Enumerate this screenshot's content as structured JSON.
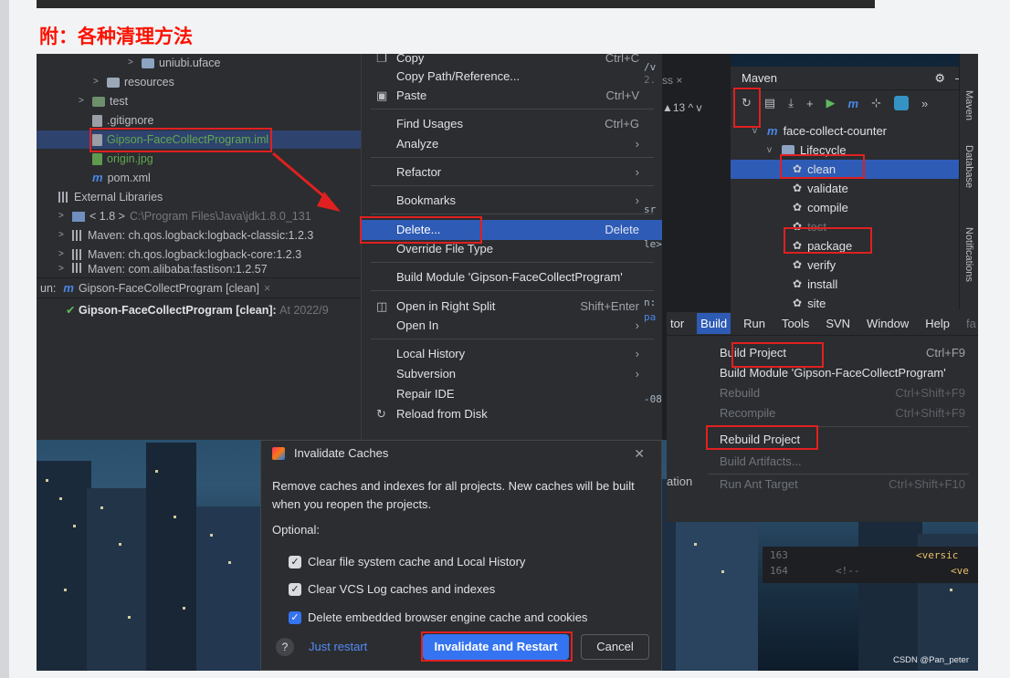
{
  "page": {
    "heading": "附：各种清理方法",
    "watermark": "CSDN @Pan_peter"
  },
  "project_tree": {
    "items": [
      {
        "label": "uniubi.uface"
      },
      {
        "label": "resources"
      },
      {
        "label": "test"
      },
      {
        "label": ".gitignore"
      },
      {
        "label": "Gipson-FaceCollectProgram.iml"
      },
      {
        "label": "origin.jpg"
      },
      {
        "label": "pom.xml"
      },
      {
        "label": "External Libraries"
      },
      {
        "label": "< 1.8 >",
        "detail": "C:\\Program Files\\Java\\jdk1.8.0_131"
      },
      {
        "label": "Maven: ch.qos.logback:logback-classic:1.2.3"
      },
      {
        "label": "Maven: ch.qos.logback:logback-core:1.2.3"
      },
      {
        "label": "Maven: com.alibaba:fastjson:1.2.57"
      }
    ]
  },
  "run_panel": {
    "prefix": "un:",
    "tab": "Gipson-FaceCollectProgram [clean]",
    "line": "Gipson-FaceCollectProgram [clean]:",
    "time": "At 2022/9"
  },
  "context_menu": {
    "items": [
      {
        "label": "Copy",
        "shortcut": "Ctrl+C"
      },
      {
        "label": "Copy Path/Reference...",
        "shortcut": ""
      },
      {
        "label": "Paste",
        "shortcut": "Ctrl+V"
      },
      {
        "label": "Find Usages",
        "shortcut": "Ctrl+G"
      },
      {
        "label": "Analyze",
        "shortcut": "›"
      },
      {
        "label": "Refactor",
        "shortcut": "›"
      },
      {
        "label": "Bookmarks",
        "shortcut": "›"
      },
      {
        "label": "Delete...",
        "shortcut": "Delete"
      },
      {
        "label": "Override File Type",
        "shortcut": ""
      },
      {
        "label": "Build Module 'Gipson-FaceCollectProgram'",
        "shortcut": ""
      },
      {
        "label": "Open in Right Split",
        "shortcut": "Shift+Enter"
      },
      {
        "label": "Open In",
        "shortcut": "›"
      },
      {
        "label": "Local History",
        "shortcut": "›"
      },
      {
        "label": "Subversion",
        "shortcut": "›"
      },
      {
        "label": "Repair IDE",
        "shortcut": ""
      },
      {
        "label": "Reload from Disk",
        "shortcut": ""
      }
    ]
  },
  "editor_fragments": {
    "a": "/v",
    "b": "2.",
    "c": "sr",
    "d": "le>",
    "e": "n:",
    "f": "pa",
    "g": "-08",
    "h": "ation",
    "tab": "ss ×",
    "counter": "▲13 ^ v"
  },
  "maven": {
    "title": "Maven",
    "toolbar": {
      "run": "▶",
      "m": "m",
      "skip": "⊹",
      "more": "»"
    },
    "project": "face-collect-counter",
    "lifecycle": "Lifecycle",
    "goals": [
      "clean",
      "validate",
      "compile",
      "test",
      "package",
      "verify",
      "install",
      "site"
    ]
  },
  "side_tabs": [
    "Maven",
    "Database",
    "Notifications"
  ],
  "build_menu": {
    "menubar": [
      "tor",
      "Build",
      "Run",
      "Tools",
      "SVN",
      "Window",
      "Help",
      "fa"
    ],
    "items": [
      {
        "label": "Build Project",
        "shortcut": "Ctrl+F9",
        "enabled": true
      },
      {
        "label": "Build Module 'Gipson-FaceCollectProgram'",
        "shortcut": "",
        "enabled": true
      },
      {
        "label": "Rebuild",
        "shortcut": "Ctrl+Shift+F9",
        "enabled": false
      },
      {
        "label": "Recompile",
        "shortcut": "Ctrl+Shift+F9",
        "enabled": false
      },
      {
        "label": "Rebuild Project",
        "shortcut": "",
        "enabled": true
      },
      {
        "label": "Build Artifacts...",
        "shortcut": "",
        "enabled": false
      },
      {
        "label": "Run Ant Target",
        "shortcut": "Ctrl+Shift+F10",
        "enabled": false
      }
    ]
  },
  "xml_snippet": {
    "line1_no": "163",
    "line1": "<versic",
    "line2_no": "164",
    "line2": "<!--",
    "line2b": "<ve"
  },
  "dialog": {
    "title": "Invalidate Caches",
    "description": "Remove caches and indexes for all projects. New caches will be built when you reopen the projects.",
    "optional_label": "Optional:",
    "options": [
      {
        "label": "Clear file system cache and Local History",
        "checked": true
      },
      {
        "label": "Clear VCS Log caches and indexes",
        "checked": true
      },
      {
        "label": "Delete embedded browser engine cache and cookies",
        "checked": true
      }
    ],
    "help": "?",
    "just_restart": "Just restart",
    "primary_button": "Invalidate and Restart",
    "cancel_button": "Cancel"
  },
  "colors": {
    "heading": "#fc1200",
    "highlight": "#e02020",
    "selection": "#2e5bb5",
    "accent": "#3574f0"
  }
}
